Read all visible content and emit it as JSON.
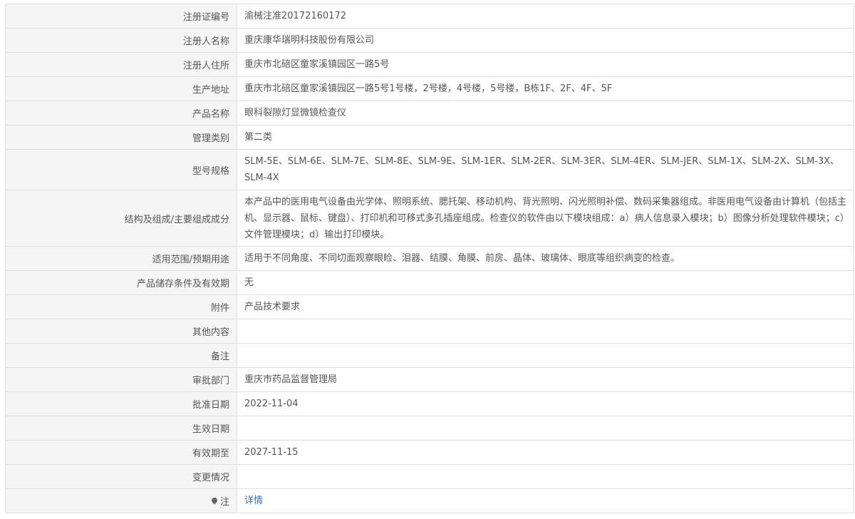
{
  "rows": [
    {
      "label": "注册证编号",
      "value": "渝械注准20172160172"
    },
    {
      "label": "注册人名称",
      "value": "重庆康华瑞明科技股份有限公司"
    },
    {
      "label": "注册人住所",
      "value": "重庆市北碚区童家溪镇园区一路5号"
    },
    {
      "label": "生产地址",
      "value": "重庆市北碚区童家溪镇园区一路5号1号楼，2号楼，4号楼，5号楼，B栋1F、2F、4F、5F"
    },
    {
      "label": "产品名称",
      "value": "眼科裂隙灯显微镜检查仪"
    },
    {
      "label": "管理类别",
      "value": "第二类"
    },
    {
      "label": "型号规格",
      "value": "SLM-5E、SLM-6E、SLM-7E、SLM-8E、SLM-9E、SLM-1ER、SLM-2ER、SLM-3ER、SLM-4ER、SLM-JER、SLM-1X、SLM-2X、SLM-3X、SLM-4X"
    },
    {
      "label": "结构及组成/主要组成成分",
      "value": "本产品中的医用电气设备由光学体、照明系统、腮托架、移动机构、背光照明、闪光照明补偿、数码采集器组成。非医用电气设备由计算机（包括主机、显示器、鼠标、键盘）、打印机和可移式多孔插座组成。检查仪的软件由以下模块组成：a）病人信息录入模块；b）图像分析处理软件模块；c）文件管理模块；d）输出打印模块。"
    },
    {
      "label": "适用范围/预期用途",
      "value": "适用于不同角度、不同切面观察眼睑、泪器、结膜、角膜、前房、晶体、玻璃体、眼底等组织病变的检查。"
    },
    {
      "label": "产品储存条件及有效期",
      "value": "无"
    },
    {
      "label": "附件",
      "value": "产品技术要求"
    },
    {
      "label": "其他内容",
      "value": ""
    },
    {
      "label": "备注",
      "value": ""
    },
    {
      "label": "审批部门",
      "value": "重庆市药品监督管理局"
    },
    {
      "label": "批准日期",
      "value": "2022-11-04"
    },
    {
      "label": "生效日期",
      "value": ""
    },
    {
      "label": "有效期至",
      "value": "2027-11-15"
    },
    {
      "label": "变更情况",
      "value": ""
    }
  ],
  "note": {
    "label": "注",
    "link": "详情",
    "icon": "lightbulb-icon"
  }
}
